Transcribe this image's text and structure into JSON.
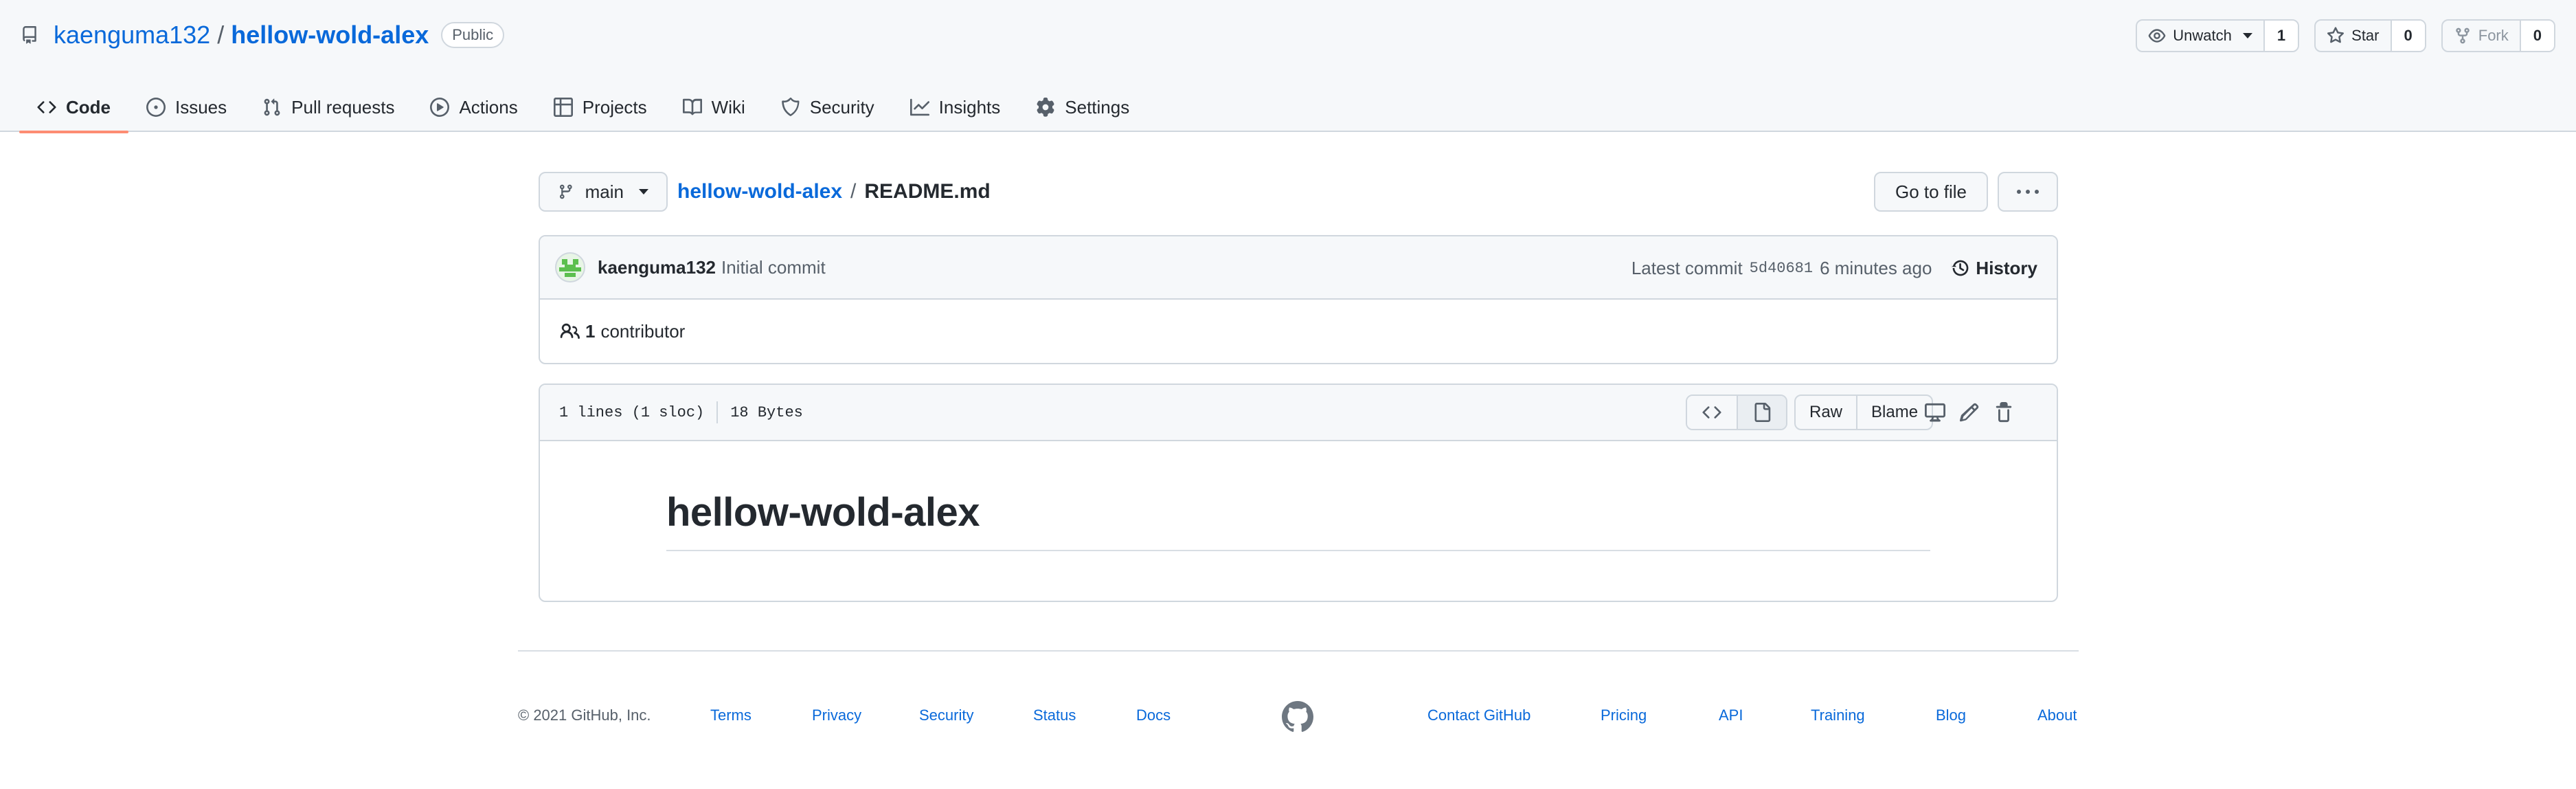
{
  "repo": {
    "owner": "kaenguma132",
    "separator": "/",
    "name": "hellow-wold-alex",
    "visibility": "Public"
  },
  "actions": {
    "watch": {
      "label": "Unwatch",
      "count": "1"
    },
    "star": {
      "label": "Star",
      "count": "0"
    },
    "fork": {
      "label": "Fork",
      "count": "0"
    }
  },
  "nav": {
    "items": [
      {
        "label": "Code",
        "icon": "code-icon",
        "selected": true
      },
      {
        "label": "Issues",
        "icon": "issue-opened-icon"
      },
      {
        "label": "Pull requests",
        "icon": "git-pull-request-icon"
      },
      {
        "label": "Actions",
        "icon": "play-icon"
      },
      {
        "label": "Projects",
        "icon": "table-icon"
      },
      {
        "label": "Wiki",
        "icon": "book-icon"
      },
      {
        "label": "Security",
        "icon": "shield-icon"
      },
      {
        "label": "Insights",
        "icon": "graph-icon"
      },
      {
        "label": "Settings",
        "icon": "gear-icon"
      }
    ]
  },
  "file_nav": {
    "branch": "main",
    "crumb_repo": "hellow-wold-alex",
    "crumb_sep": "/",
    "crumb_file": "README.md",
    "goto_label": "Go to file"
  },
  "commit": {
    "author": "kaenguma132",
    "message": "Initial commit",
    "latest_label": "Latest commit",
    "sha": "5d40681",
    "time": "6 minutes ago",
    "history_label": "History",
    "contributors_count": "1",
    "contributors_label": "contributor"
  },
  "file": {
    "lines": "1 lines (1 sloc)",
    "size": "18 Bytes",
    "raw_label": "Raw",
    "blame_label": "Blame",
    "readme_heading": "hellow-wold-alex"
  },
  "footer": {
    "copyright": "© 2021 GitHub, Inc.",
    "links_left": [
      "Terms",
      "Privacy",
      "Security",
      "Status",
      "Docs"
    ],
    "links_right": [
      "Contact GitHub",
      "Pricing",
      "API",
      "Training",
      "Blog",
      "About"
    ]
  },
  "colors": {
    "link": "#0969da",
    "selected_tab_underline": "#fd8c73",
    "border": "#d0d7de",
    "header_bg": "#f6f8fa"
  }
}
